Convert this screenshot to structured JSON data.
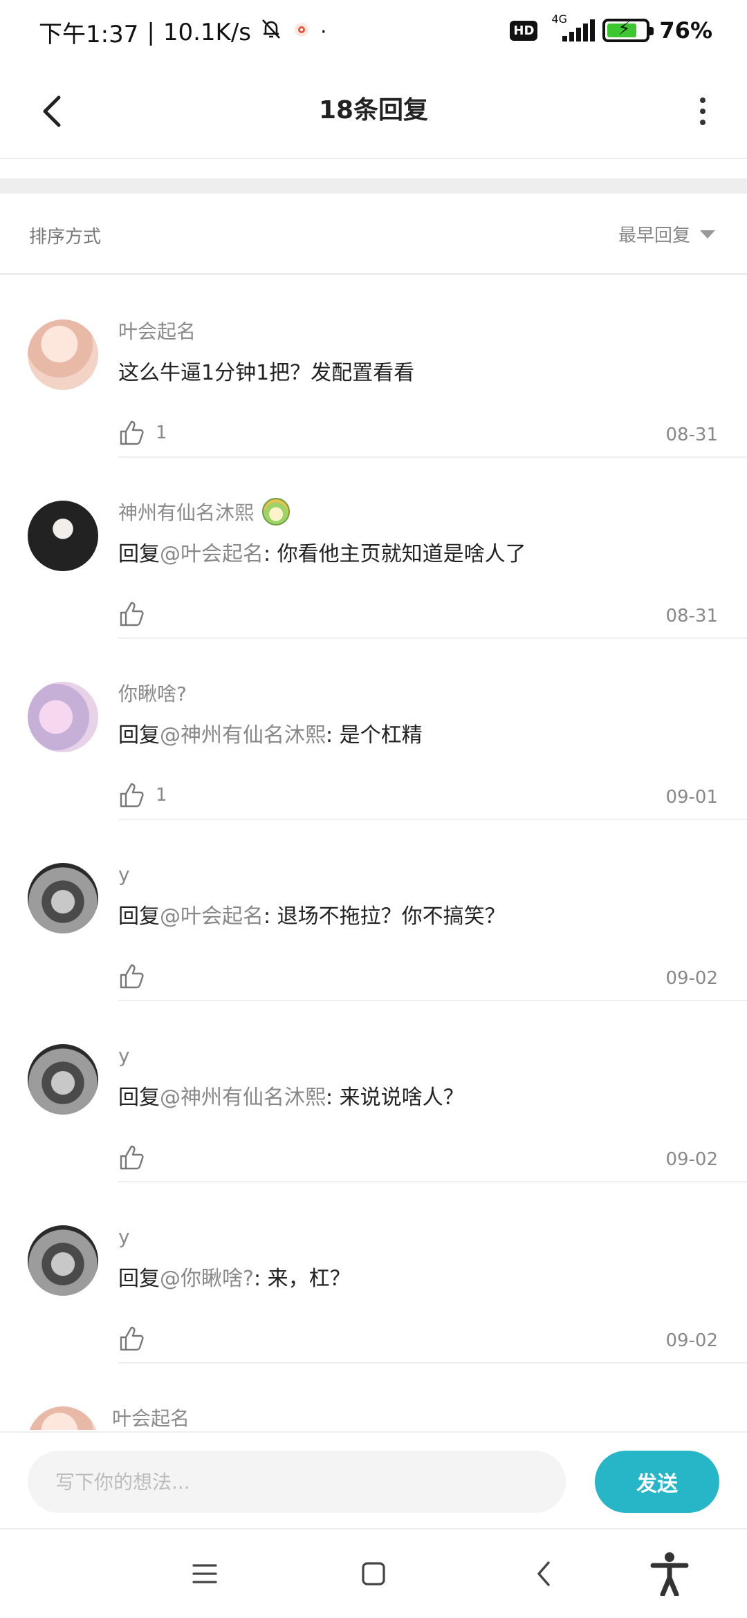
{
  "status_bar": {
    "time": "下午1:37",
    "net_speed": "10.1K/s",
    "hd": "HD",
    "network": "4G",
    "battery": "76%"
  },
  "header": {
    "title": "18条回复"
  },
  "sort": {
    "label": "排序方式",
    "selected": "最早回复"
  },
  "comments": [
    {
      "user": "叶会起名",
      "content": "这么牛逼1分钟1把？发配置看看",
      "mention": "",
      "likes": "1",
      "date": "08-31"
    },
    {
      "user": "神州有仙名沐熙",
      "reply_prefix": "回复",
      "mention": "@叶会起名",
      "content": ": 你看他主页就知道是啥人了",
      "likes": "",
      "date": "08-31"
    },
    {
      "user": "你瞅啥?",
      "reply_prefix": "回复",
      "mention": "@神州有仙名沐熙",
      "content": ": 是个杠精",
      "likes": "1",
      "date": "09-01"
    },
    {
      "user": "y",
      "reply_prefix": "回复",
      "mention": "@叶会起名",
      "content": ": 退场不拖拉？你不搞笑？",
      "likes": "",
      "date": "09-02"
    },
    {
      "user": "y",
      "reply_prefix": "回复",
      "mention": "@神州有仙名沐熙",
      "content": ": 来说说啥人？",
      "likes": "",
      "date": "09-02"
    },
    {
      "user": "y",
      "reply_prefix": "回复",
      "mention": "@你瞅啥?",
      "content": ": 来，杠？",
      "likes": "",
      "date": "09-02"
    },
    {
      "user": "叶会起名"
    }
  ],
  "composer": {
    "placeholder": "写下你的想法...",
    "send_label": "发送"
  },
  "colors": {
    "accent": "#26b6c8",
    "battery_fill": "#3cc62f",
    "secondary_text": "#888888",
    "divider": "#eeeeee"
  }
}
